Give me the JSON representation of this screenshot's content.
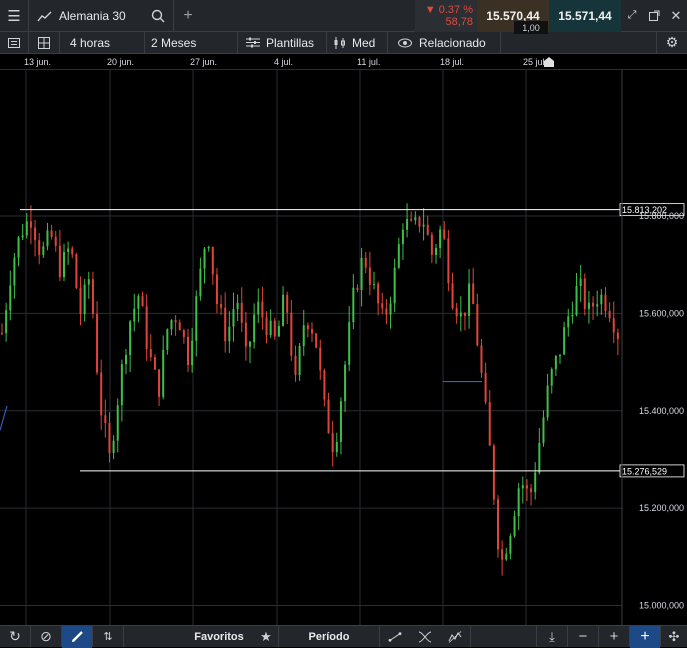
{
  "header": {
    "instrument": "Alemania 30",
    "change_percent": "▼ 0.37 %",
    "change_points": "58,78",
    "sell_price": "15.570,44",
    "spread": "1,00",
    "buy_price": "15.571,44"
  },
  "toolbar": {
    "timeframe": "4 horas",
    "range": "2 Meses",
    "templates": "Plantillas",
    "price_type": "Med",
    "related": "Relacionado"
  },
  "dates": [
    "13 jun.",
    "20 jun.",
    "27 jun.",
    "4 jul.",
    "11 jul.",
    "18 jul.",
    "25 jul."
  ],
  "bottom": {
    "favorites": "Favoritos",
    "period": "Período"
  },
  "colors": {
    "up": "#3fbf4a",
    "down": "#e0453a",
    "grid": "#2a2d32",
    "background": "#000000",
    "panel": "#23262b"
  },
  "chart_data": {
    "type": "candlestick",
    "instrument": "Alemania 30",
    "timeframe": "4 horas",
    "ylim": [
      14960000,
      16100000
    ],
    "y_ticks": [
      {
        "value": 15800000,
        "label": "15.800,000"
      },
      {
        "value": 15600000,
        "label": "15.600,000"
      },
      {
        "value": 15400000,
        "label": "15.400,000"
      },
      {
        "value": 15200000,
        "label": "15.200,000"
      },
      {
        "value": 15000000,
        "label": "15.000,000"
      }
    ],
    "horizontal_lines": [
      {
        "value": 15813202,
        "label": "15.813,202"
      },
      {
        "value": 15276529,
        "label": "15.276,529"
      }
    ],
    "path": [
      15560000,
      15700000,
      15770000,
      15800000,
      15720000,
      15760000,
      15690000,
      15740000,
      15600000,
      15680000,
      15420000,
      15300000,
      15450000,
      15580000,
      15640000,
      15520000,
      15440000,
      15580000,
      15600000,
      15510000,
      15640000,
      15780000,
      15620000,
      15550000,
      15640000,
      15500000,
      15620000,
      15580000,
      15540000,
      15640000,
      15450000,
      15600000,
      15560000,
      15400000,
      15320000,
      15480000,
      15640000,
      15720000,
      15650000,
      15580000,
      15660000,
      15790000,
      15770000,
      15800000,
      15720000,
      15780000,
      15640000,
      15590000,
      15650000,
      15480000,
      15300000,
      15080000,
      15160000,
      15260000,
      15220000,
      15340000,
      15460000,
      15520000,
      15600000,
      15660000,
      15600000,
      15640000,
      15620000,
      15560000
    ]
  }
}
